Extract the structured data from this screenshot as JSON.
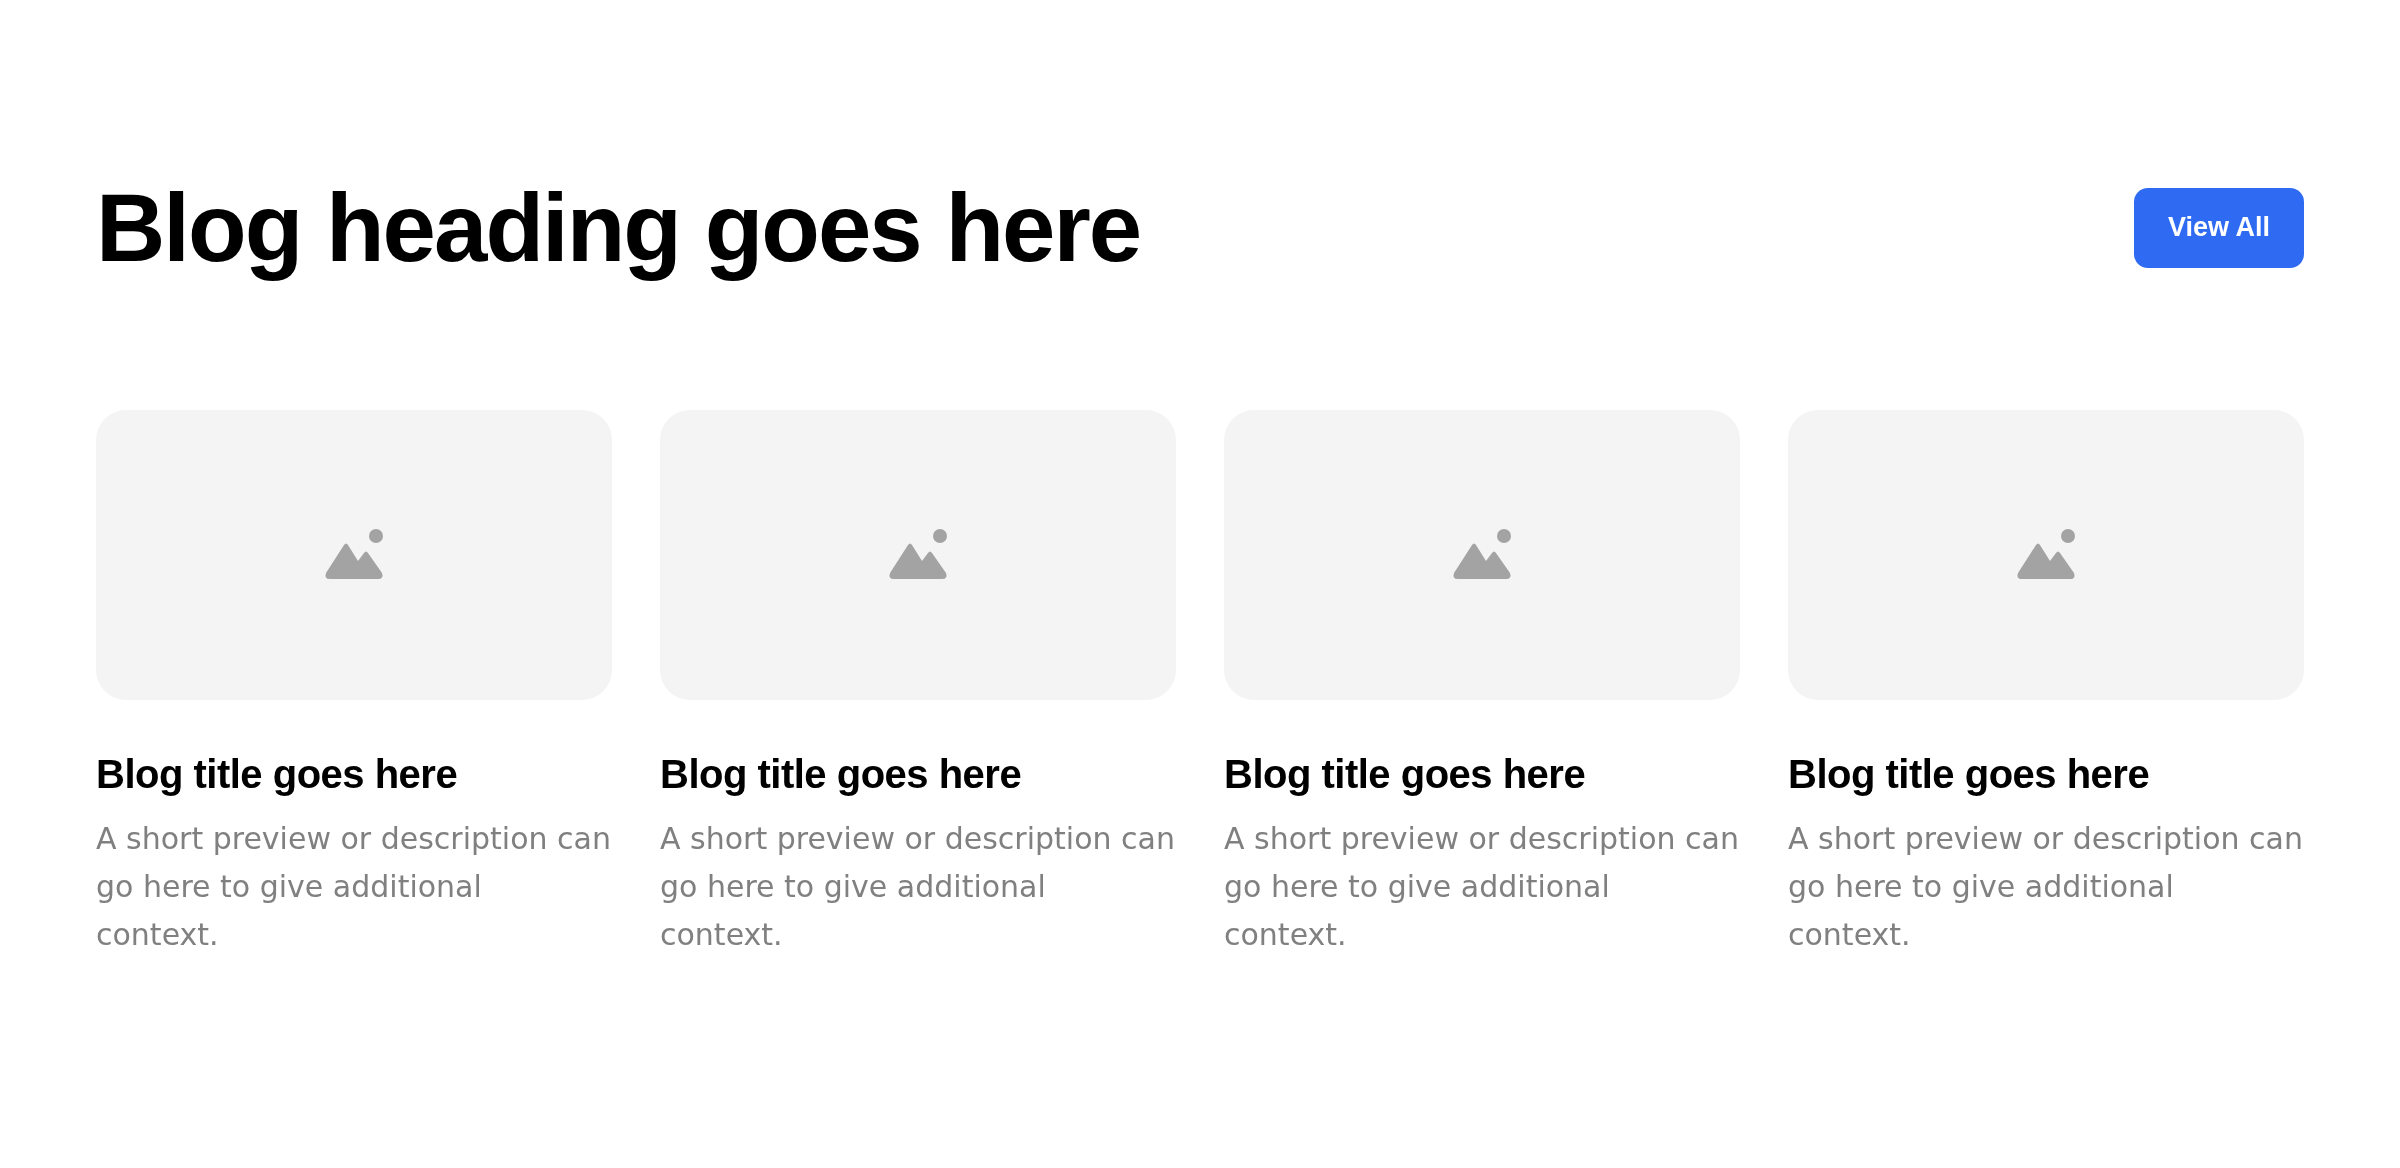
{
  "header": {
    "heading": "Blog heading goes here",
    "button": "View All"
  },
  "posts": [
    {
      "title": "Blog title goes here",
      "description": "A short preview or description can go here to give additional context."
    },
    {
      "title": "Blog title goes here",
      "description": "A short preview or description can go here to give additional context."
    },
    {
      "title": "Blog title goes here",
      "description": "A short preview or description can go here to give additional context."
    },
    {
      "title": "Blog title goes here",
      "description": "A short preview or description can go here to give additional context."
    }
  ]
}
